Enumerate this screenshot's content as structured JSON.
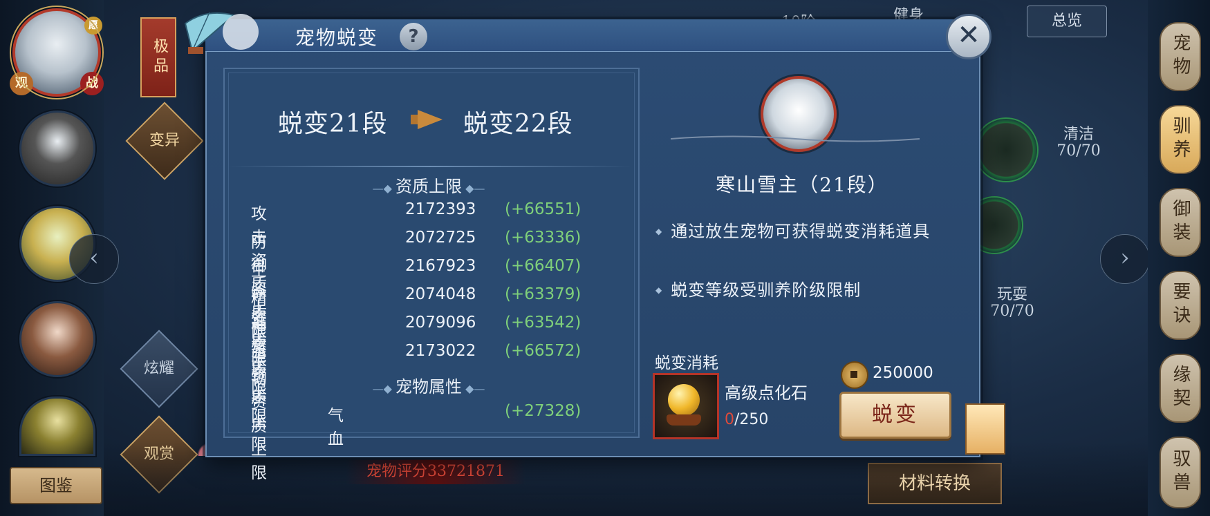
{
  "background": {
    "rank_box": "极品",
    "diamond_top": "变异",
    "diamond_left_mid": "炫耀",
    "diamond_left_bottom": "观赏",
    "illustrated_button": "图鉴",
    "avatar_tags": {
      "left": "观",
      "right": "战",
      "top": "愿"
    },
    "top_label_1": "10阶",
    "top_label_2": "健身",
    "overview_button": "总览",
    "stat_clean": {
      "label": "清洁",
      "value": "70/70"
    },
    "stat_play": {
      "label": "玩耍",
      "value": "70/70"
    },
    "pet_score": "宠物评分33721871",
    "material_button": "材料转换",
    "right_tabs": [
      "宠物",
      "驯养",
      "御装",
      "要诀",
      "缘契",
      "驭兽"
    ],
    "active_right_tab": "驯养",
    "prev_arrow": "‹",
    "next_arrow": "›"
  },
  "dialog": {
    "title": "宠物蜕变",
    "help_symbol": "?",
    "close_symbol": "✕",
    "evolution": {
      "from": "蜕变21段",
      "to": "蜕变22段"
    },
    "aptitude_section": "资质上限",
    "aptitudes": [
      {
        "name": "攻击资质上限",
        "value": "2172393",
        "delta": "(+66551)"
      },
      {
        "name": "防御资质上限",
        "value": "2072725",
        "delta": "(+63336)"
      },
      {
        "name": "生命资质上限",
        "value": "2167923",
        "delta": "(+66407)"
      },
      {
        "name": "精准资质上限",
        "value": "2074048",
        "delta": "(+63379)"
      },
      {
        "name": "神圣资质上限",
        "value": "2079096",
        "delta": "(+63542)"
      },
      {
        "name": "坚韧资质上限",
        "value": "2173022",
        "delta": "(+66572)"
      }
    ],
    "attribute_section": "宠物属性",
    "attributes": [
      {
        "name": "气血",
        "delta": "(+27328)"
      }
    ],
    "pet_name": "寒山雪主（21段）",
    "tips": [
      "通过放生宠物可获得蜕变消耗道具",
      "蜕变等级受驯养阶级限制"
    ],
    "cost_label": "蜕变消耗",
    "item_name": "高级点化石",
    "item_have": "0",
    "item_need": "/250",
    "coin_amount": "250000",
    "evolve_button": "蜕变"
  },
  "colors": {
    "dialog_bg": "#2c4c74",
    "positive_delta": "#7fd07a",
    "insufficient": "#e04a3a",
    "accent_red": "#b03a2a"
  }
}
